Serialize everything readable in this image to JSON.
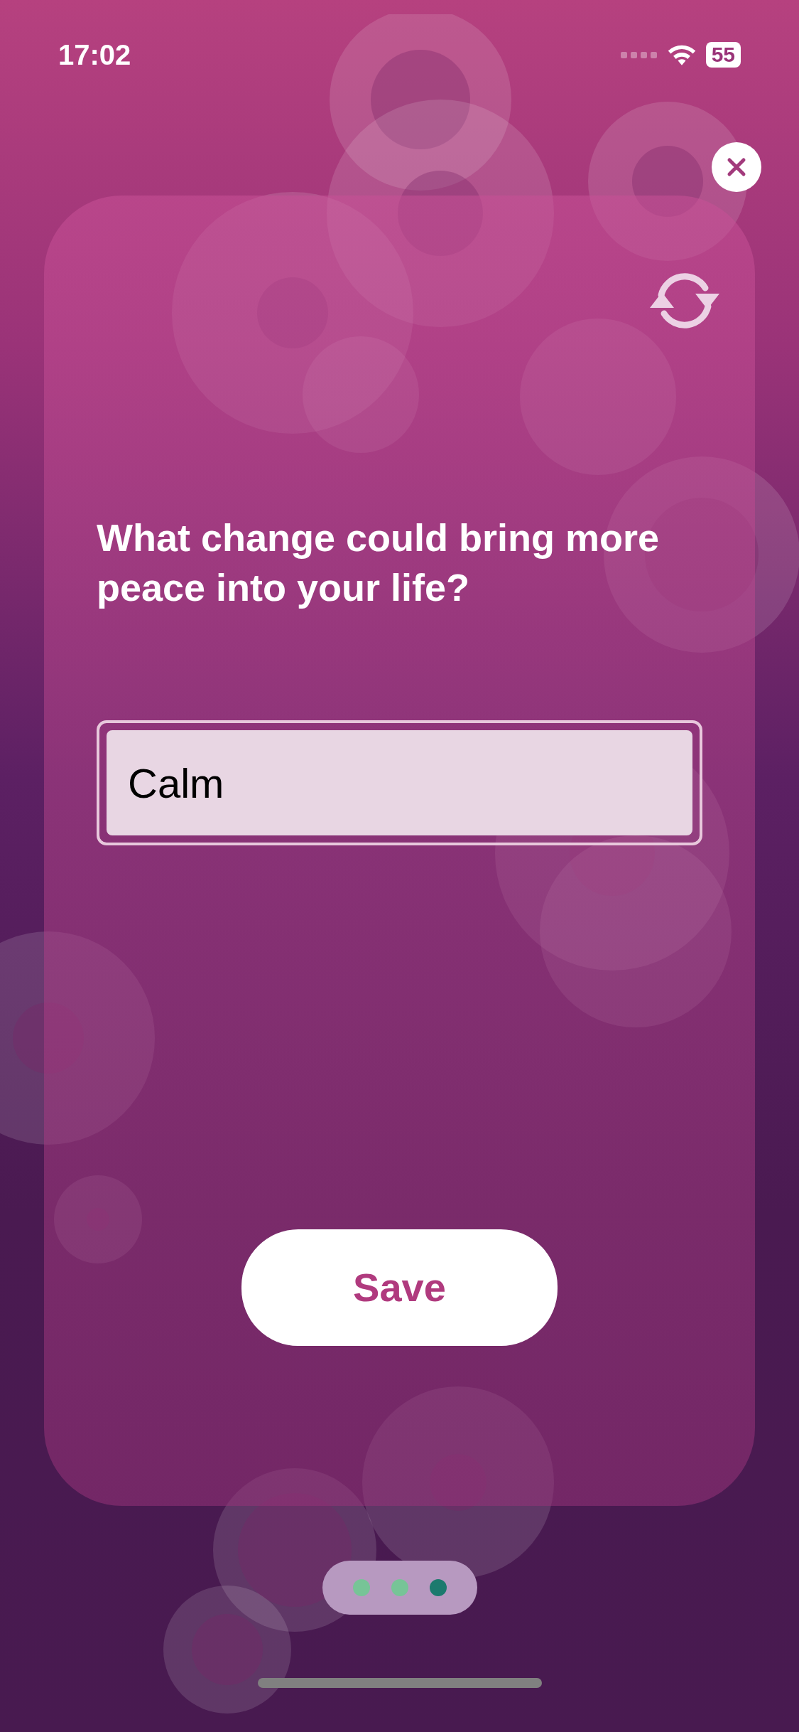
{
  "status_bar": {
    "time": "17:02",
    "battery": "55"
  },
  "question": "What change could bring more peace into your life?",
  "answer": {
    "value": "Calm"
  },
  "save_button": "Save",
  "pages": [
    {
      "selected": false
    },
    {
      "selected": false
    },
    {
      "selected": true
    }
  ]
}
